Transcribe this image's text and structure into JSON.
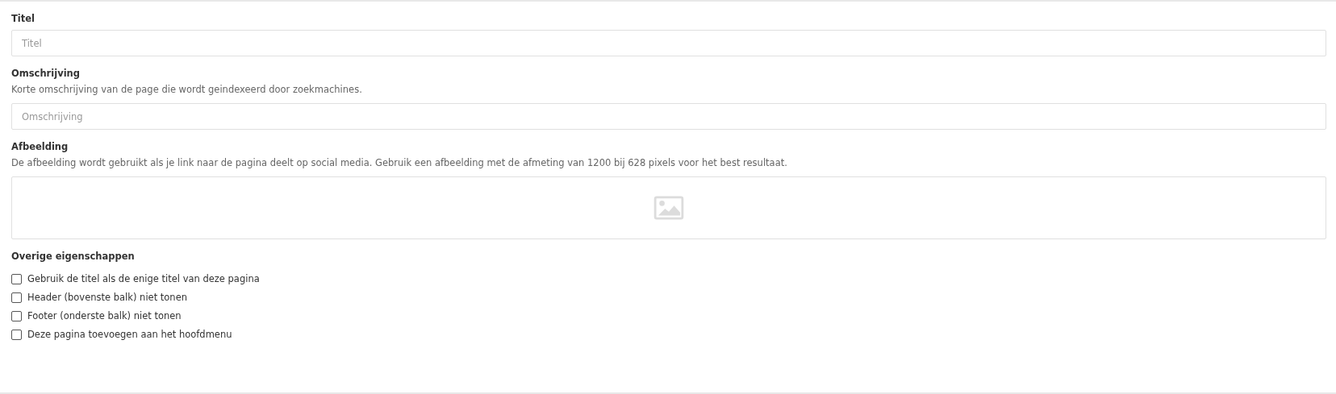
{
  "fields": [
    {
      "kind": "text",
      "label": "Titel",
      "placeholder": "Titel"
    },
    {
      "kind": "text",
      "label": "Omschrijving",
      "help": "Korte omschrijving van de page die wordt geindexeerd door zoekmachines.",
      "placeholder": "Omschrijving"
    },
    {
      "kind": "image",
      "label": "Afbeelding",
      "help": "De afbeelding wordt gebruikt als je link naar de pagina deelt op social media. Gebruik een afbeelding met de afmeting van 1200 bij 628 pixels voor het best resultaat."
    }
  ],
  "options": {
    "label": "Overige eigenschappen",
    "items": [
      {
        "label": "Gebruik de titel als de enige titel van deze pagina",
        "checked": false
      },
      {
        "label": "Header (bovenste balk) niet tonen",
        "checked": false
      },
      {
        "label": "Footer (onderste balk) niet tonen",
        "checked": false
      },
      {
        "label": "Deze pagina toevoegen aan het hoofdmenu",
        "checked": false
      }
    ]
  }
}
